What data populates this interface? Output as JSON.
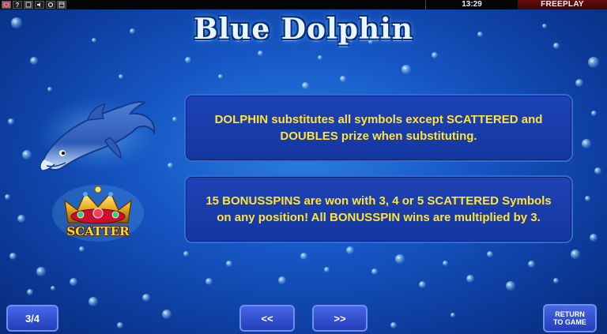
{
  "topbar": {
    "clock": "13:29",
    "mode": "FREEPLAY",
    "icons": [
      "flag-icon",
      "help-icon",
      "fullscreen-icon",
      "sound-icon",
      "settings-icon",
      "window-icon"
    ],
    "help_glyph": "?"
  },
  "title": "Blue Dolphin",
  "rules": [
    {
      "symbol": "DOLPHIN",
      "text": "DOLPHIN substitutes all symbols except SCATTERED and DOUBLES prize when substituting."
    },
    {
      "symbol": "SCATTER",
      "text": "15 BONUSSPINS are won with 3, 4 or 5 SCATTERED Symbols on any position! All BONUSSPIN wins are multiplied by 3."
    }
  ],
  "scatter_label": "SCATTER",
  "navigation": {
    "page": "3/4",
    "prev_label": "<<",
    "next_label": ">>",
    "return_line1": "RETURN",
    "return_line2": "TO GAME"
  },
  "colors": {
    "text_yellow": "#ffe33a",
    "box_blue": "#1e43b6",
    "freeplay_red": "#6a0d0d"
  }
}
